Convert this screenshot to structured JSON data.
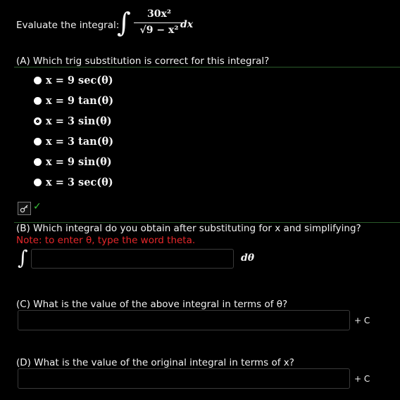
{
  "header": {
    "prompt": "Evaluate the integral:",
    "integral_symbol": "∫",
    "numerator": "30x²",
    "denominator": "√9 − x²",
    "differential": "dx"
  },
  "partA": {
    "question": "(A) Which trig substitution is correct for this integral?",
    "options": [
      {
        "label": "x = 9 sec(θ)",
        "selected": false
      },
      {
        "label": "x = 9 tan(θ)",
        "selected": false
      },
      {
        "label": "x = 3 sin(θ)",
        "selected": true
      },
      {
        "label": "x = 3 tan(θ)",
        "selected": false
      },
      {
        "label": "x = 9 sin(θ)",
        "selected": false
      },
      {
        "label": "x = 3 sec(θ)",
        "selected": false
      }
    ],
    "feedback_icon": "key-icon",
    "check_icon": "✓"
  },
  "partB": {
    "question": "(B) Which integral do you obtain after substituting for x and simplifying?",
    "note": "Note: to enter θ, type the word theta.",
    "integral_symbol": "∫",
    "input_value": "",
    "differential": "dθ"
  },
  "partC": {
    "question": "(C) What is the value of the above integral in terms of θ?",
    "input_value": "",
    "suffix": "+ C"
  },
  "partD": {
    "question": "(D) What is the value of the original integral in terms of x?",
    "input_value": "",
    "suffix": "+ C"
  },
  "colors": {
    "background": "#000000",
    "text": "#f2f2f2",
    "note": "#e8282b",
    "check": "#3cc63c",
    "rule": "#2a5a2a"
  }
}
